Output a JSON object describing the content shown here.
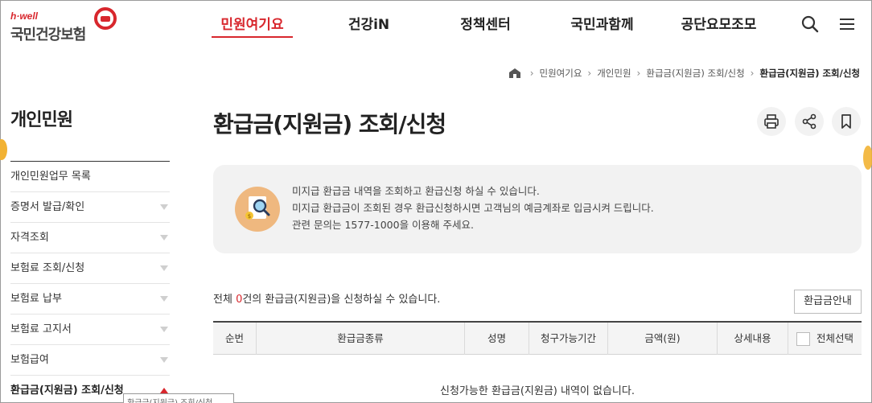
{
  "header": {
    "logo_sub": "h·well",
    "logo_main": "국민건강보험",
    "nav": [
      "민원여기요",
      "건강iN",
      "정책센터",
      "국민과함께",
      "공단요모조모"
    ],
    "active_nav": 0
  },
  "breadcrumb": [
    "민원여기요",
    "개인민원",
    "환급금(지원금) 조회/신청",
    "환급금(지원금) 조회/신청"
  ],
  "sidebar": {
    "title": "개인민원",
    "items": [
      {
        "label": "개인민원업무 목록"
      },
      {
        "label": "증명서 발급/확인"
      },
      {
        "label": "자격조회"
      },
      {
        "label": "보험료 조회/신청"
      },
      {
        "label": "보험료 납부"
      },
      {
        "label": "보험료 고지서"
      },
      {
        "label": "보험급여"
      },
      {
        "label": "환급금(지원금) 조회/신청"
      }
    ],
    "tooltip": "환급금(지원금) 조회/신청"
  },
  "main": {
    "title": "환급금(지원금) 조회/신청",
    "info": [
      "미지급 환급금 내역을 조회하고 환급신청 하실 수 있습니다.",
      "미지급 환급금이 조회된 경우 환급신청하시면 고객님의 예금계좌로 입금시켜 드립니다.",
      "관련 문의는 1577-1000을 이용해 주세요."
    ],
    "count_prefix": "전체 ",
    "count_num": "0",
    "count_suffix": "건의 환급금(지원금)을 신청하실 수 있습니다.",
    "guide_button": "환급금안내",
    "columns": [
      "순번",
      "환급금종류",
      "성명",
      "청구가능기간",
      "금액(원)",
      "상세내용",
      "전체선택"
    ],
    "empty_message": "신청가능한 환급금(지원금) 내역이 없습니다."
  },
  "colors": {
    "brand_red": "#d8272d",
    "info_bg": "#f2f2f2"
  }
}
